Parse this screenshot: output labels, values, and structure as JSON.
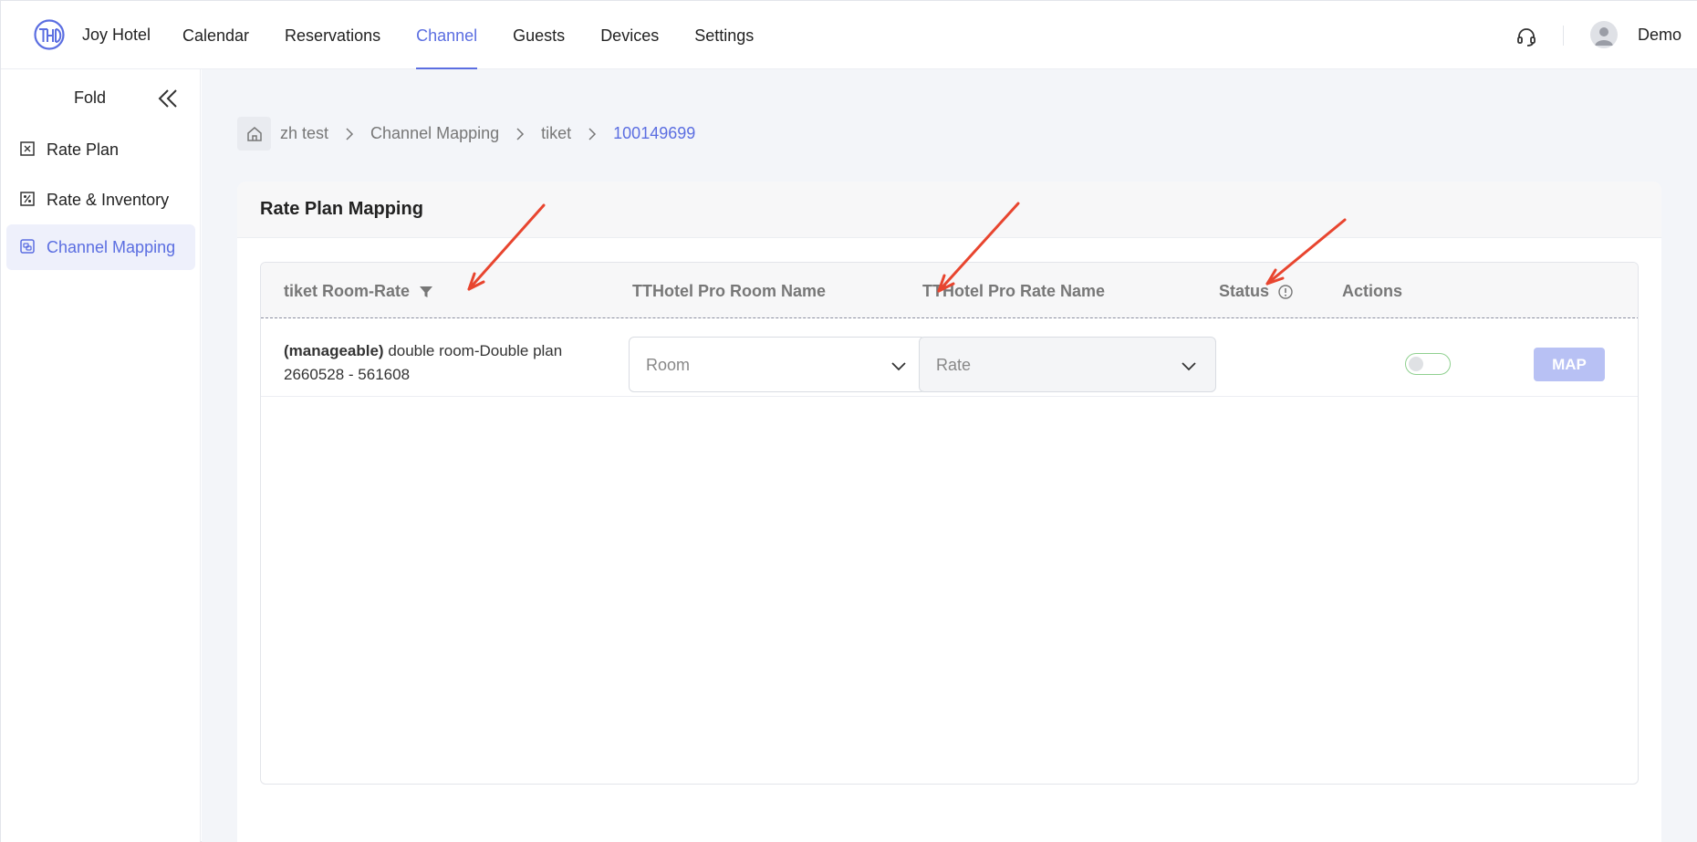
{
  "header": {
    "brand": "Joy Hotel",
    "nav": [
      {
        "label": "Calendar",
        "active": false
      },
      {
        "label": "Reservations",
        "active": false
      },
      {
        "label": "Channel",
        "active": true
      },
      {
        "label": "Guests",
        "active": false
      },
      {
        "label": "Devices",
        "active": false
      },
      {
        "label": "Settings",
        "active": false
      }
    ],
    "username": "Demo",
    "accent_color": "#5b6ee1"
  },
  "sidebar": {
    "fold_label": "Fold",
    "items": [
      {
        "label": "Rate Plan",
        "icon": "rate-plan-icon",
        "active": false
      },
      {
        "label": "Rate & Inventory",
        "icon": "rate-inventory-icon",
        "active": false
      },
      {
        "label": "Channel Mapping",
        "icon": "channel-mapping-icon",
        "active": true
      }
    ]
  },
  "breadcrumb": {
    "items": [
      "zh test",
      "Channel Mapping",
      "tiket"
    ],
    "current": "100149699"
  },
  "card": {
    "title": "Rate Plan Mapping"
  },
  "table": {
    "headers": {
      "room_rate": "tiket Room-Rate",
      "room_name": "TTHotel Pro Room Name",
      "rate_name": "TTHotel Pro Rate Name",
      "status": "Status",
      "actions": "Actions"
    },
    "rows": [
      {
        "tag": "(manageable)",
        "name": " double room-Double plan",
        "ids": "2660528 - 561608",
        "room_placeholder": "Room",
        "rate_placeholder": "Rate",
        "status_on": false,
        "action_label": "MAP"
      }
    ]
  },
  "annotation_color": "#e8452f"
}
